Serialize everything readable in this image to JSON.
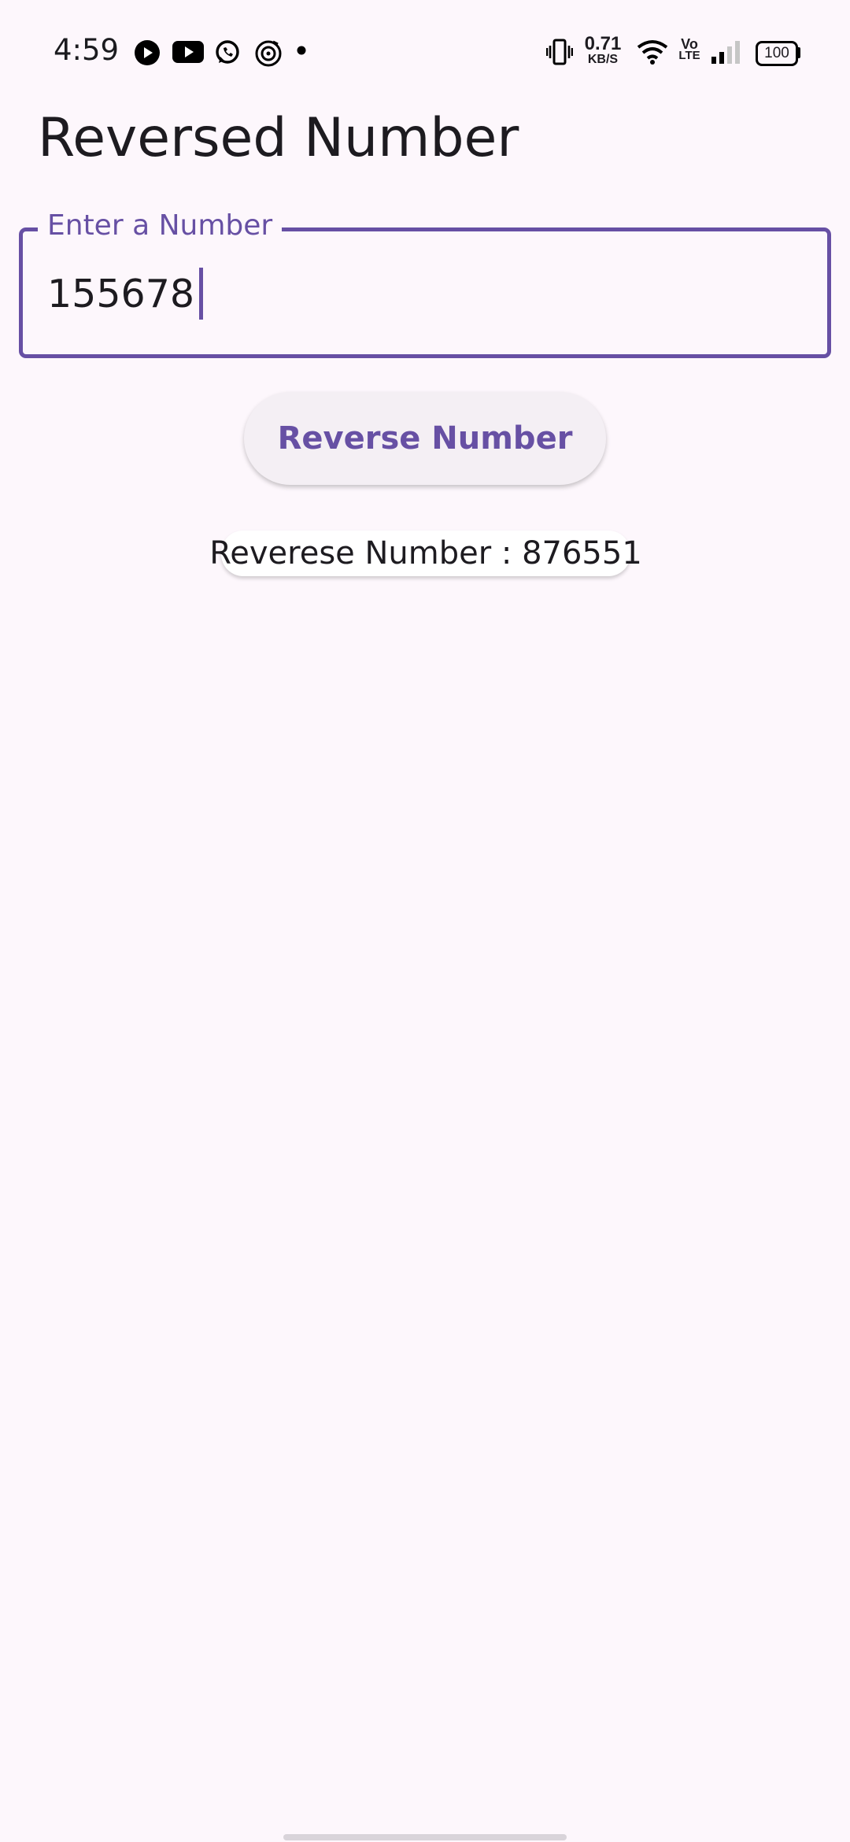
{
  "status_bar": {
    "time": "4:59",
    "data_speed_value": "0.71",
    "data_speed_unit": "KB/S",
    "network_type_top": "Vo",
    "network_type_bottom": "LTE",
    "battery": "100",
    "notification_icons": [
      "play-icon",
      "youtube-icon",
      "whatsapp-icon",
      "music-icon",
      "more-dot-icon"
    ],
    "system_icons": [
      "vibrate-icon",
      "wifi-icon",
      "volte-icon",
      "signal-icon",
      "battery-icon"
    ]
  },
  "app_bar": {
    "title": "Reversed Number"
  },
  "input": {
    "label": "Enter a Number",
    "value": "155678"
  },
  "button": {
    "label": "Reverse Number"
  },
  "result": {
    "text": "Reverese Number : 876551"
  },
  "colors": {
    "primary": "#6750a4",
    "background": "#fdf7fc",
    "button_bg": "#f4eff4",
    "text": "#1d1b20"
  }
}
